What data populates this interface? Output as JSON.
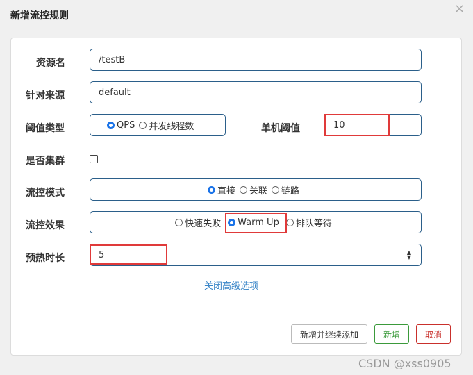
{
  "dialog": {
    "title": "新增流控规则",
    "close_glyph": "×"
  },
  "form": {
    "resource_name": {
      "label": "资源名",
      "value": "/testB"
    },
    "source": {
      "label": "针对来源",
      "value": "default"
    },
    "threshold_type": {
      "label": "阈值类型",
      "options": [
        "QPS",
        "并发线程数"
      ],
      "selected": "QPS"
    },
    "single_threshold": {
      "label": "单机阈值",
      "value": "10"
    },
    "cluster": {
      "label": "是否集群",
      "checked": false
    },
    "flow_mode": {
      "label": "流控模式",
      "options": [
        "直接",
        "关联",
        "链路"
      ],
      "selected": "直接"
    },
    "control_effect": {
      "label": "流控效果",
      "options": [
        "快速失败",
        "Warm Up",
        "排队等待"
      ],
      "selected": "Warm Up"
    },
    "warmup_period": {
      "label": "预热时长",
      "value": "5"
    }
  },
  "advanced_link": "关闭高级选项",
  "buttons": {
    "add_continue": "新增并继续添加",
    "add": "新增",
    "cancel": "取消"
  },
  "colors": {
    "border_blue": "#2b5f8a",
    "highlight_red": "#e03a3a",
    "add_green": "#3b9a3b",
    "cancel_red": "#c9302c",
    "link_blue": "#3a86c8"
  },
  "watermark": "CSDN @xss0905"
}
